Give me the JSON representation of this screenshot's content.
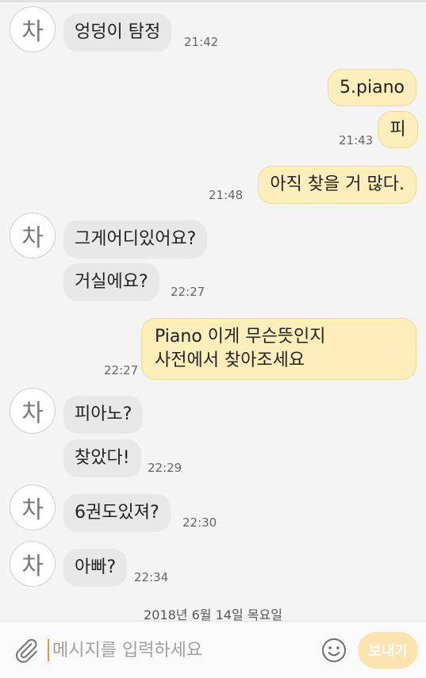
{
  "avatar_initial": "차",
  "messages": [
    {
      "text": "엉덩이 탐정",
      "time": "21:42"
    },
    {
      "text": "5.piano"
    },
    {
      "text": "피",
      "time": "21:43"
    },
    {
      "text": "아직 찾을 거 많다.",
      "time": "21:48"
    },
    {
      "text": "그게어디있어요?"
    },
    {
      "text": "거실에요?",
      "time": "22:27"
    },
    {
      "lines": [
        "Piano 이게 무슨뜻인지",
        "사전에서 찾아조세요"
      ],
      "time": "22:27"
    },
    {
      "text": "피아노?"
    },
    {
      "text": "찾았다!",
      "time": "22:29"
    },
    {
      "text": "6권도있져?",
      "time": "22:30"
    },
    {
      "text": "아빠?",
      "time": "22:34"
    }
  ],
  "date_separator": "2018년 6월 14일 목요일",
  "input": {
    "placeholder": "메시지를 입력하세요",
    "value": ""
  },
  "send_label": "보내기",
  "colors": {
    "incoming_bubble": "#e8e8e8",
    "outgoing_bubble": "#fdeebb",
    "send_button": "#fde3b0",
    "caret": "#f0922e"
  }
}
